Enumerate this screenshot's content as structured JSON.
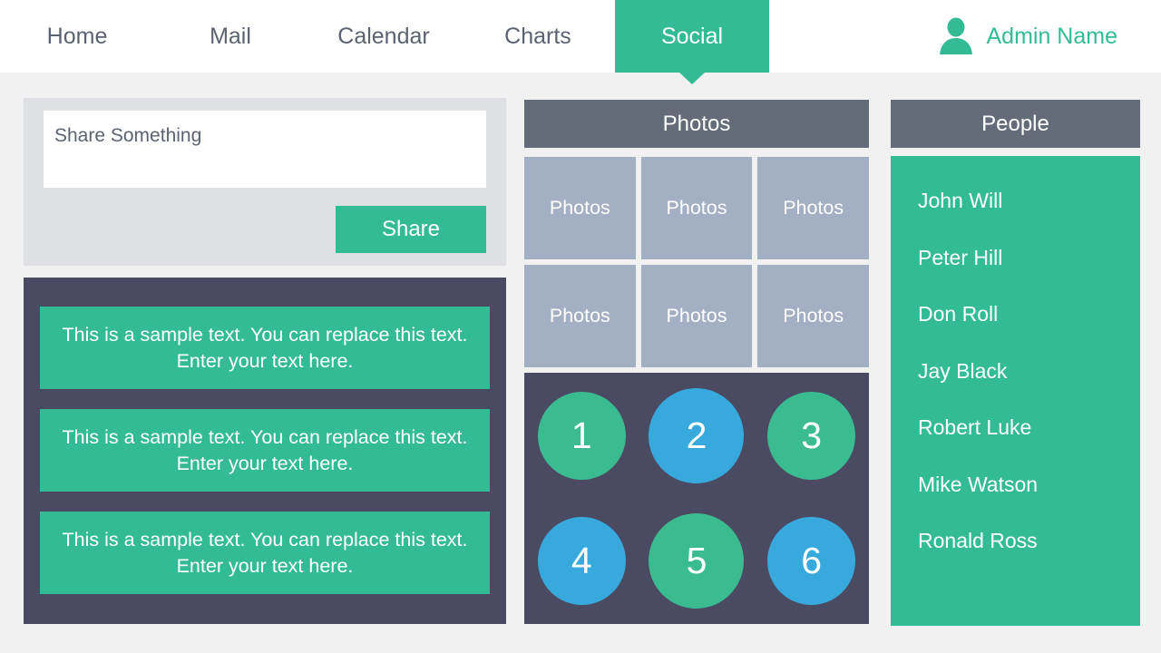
{
  "colors": {
    "page_background": "#f1f1f1",
    "accent_green": "#33bb96",
    "accent_blue": "#37a9dc",
    "dark_panel": "#4a4a62",
    "header_gray": "#646c7a",
    "photo_tile": "#a3afc3",
    "share_card": "#dfe0e4",
    "nav_text": "#5b6270"
  },
  "nav": {
    "items": [
      {
        "label": "Home",
        "active": false
      },
      {
        "label": "Mail",
        "active": false
      },
      {
        "label": "Calendar",
        "active": false
      },
      {
        "label": "Charts",
        "active": false
      },
      {
        "label": "Social",
        "active": true
      }
    ],
    "user": {
      "name": "Admin Name",
      "icon": "user-avatar-icon"
    }
  },
  "share": {
    "placeholder": "Share Something",
    "value": "",
    "button_label": "Share"
  },
  "posts": [
    {
      "text": "This is a sample text. You can replace this text. Enter your text here."
    },
    {
      "text": "This is a sample text. You can replace this text. Enter your text here."
    },
    {
      "text": "This is a sample text. You can replace this text. Enter your text here."
    }
  ],
  "photos": {
    "title": "Photos",
    "tiles": [
      {
        "label": "Photos"
      },
      {
        "label": "Photos"
      },
      {
        "label": "Photos"
      },
      {
        "label": "Photos"
      },
      {
        "label": "Photos"
      },
      {
        "label": "Photos"
      }
    ]
  },
  "circles": [
    {
      "label": "1",
      "color": "#3bbb90",
      "size": "normal"
    },
    {
      "label": "2",
      "color": "#37a9dc",
      "size": "big"
    },
    {
      "label": "3",
      "color": "#3bbb90",
      "size": "normal"
    },
    {
      "label": "4",
      "color": "#37a9dc",
      "size": "normal"
    },
    {
      "label": "5",
      "color": "#3bbb90",
      "size": "big"
    },
    {
      "label": "6",
      "color": "#37a9dc",
      "size": "normal"
    }
  ],
  "people": {
    "title": "People",
    "list": [
      {
        "name": "John Will"
      },
      {
        "name": "Peter Hill"
      },
      {
        "name": "Don Roll"
      },
      {
        "name": "Jay Black"
      },
      {
        "name": "Robert Luke"
      },
      {
        "name": "Mike Watson"
      },
      {
        "name": "Ronald Ross"
      }
    ]
  }
}
